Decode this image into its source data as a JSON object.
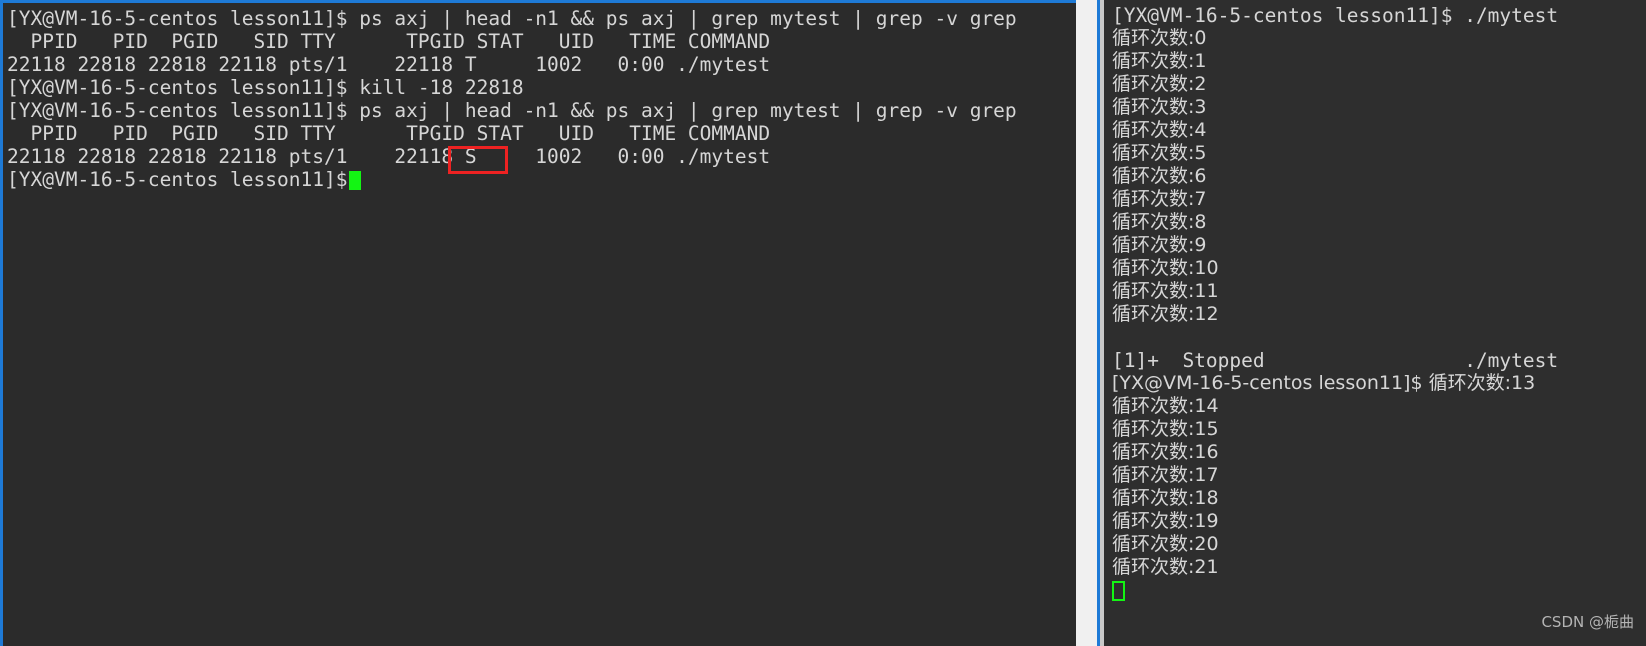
{
  "window": {
    "accent_color": "#1e7ad6",
    "terminal_bg": "#2b2b2b",
    "text_color": "#d6d6d6",
    "cursor_color": "#13f513",
    "highlight_box_color": "#ee2222"
  },
  "left_terminal": {
    "prompt": "[YX@VM-16-5-centos lesson11]$",
    "lines": [
      {
        "type": "command",
        "prompt": "[YX@VM-16-5-centos lesson11]$",
        "text": " ps axj | head -n1 && ps axj | grep mytest | grep -v grep"
      },
      {
        "type": "output",
        "text": "  PPID   PID  PGID   SID TTY      TPGID STAT   UID   TIME COMMAND"
      },
      {
        "type": "output",
        "text": "22118 22818 22818 22118 pts/1    22118 T     1002   0:00 ./mytest"
      },
      {
        "type": "command",
        "prompt": "[YX@VM-16-5-centos lesson11]$",
        "text": " kill -18 22818"
      },
      {
        "type": "command",
        "prompt": "[YX@VM-16-5-centos lesson11]$",
        "text": " ps axj | head -n1 && ps axj | grep mytest | grep -v grep"
      },
      {
        "type": "output",
        "text": "  PPID   PID  PGID   SID TTY      TPGID STAT   UID   TIME COMMAND"
      },
      {
        "type": "output",
        "text": "22118 22818 22818 22118 pts/1    22118 S     1002   0:00 ./mytest"
      },
      {
        "type": "prompt_cursor",
        "prompt": "[YX@VM-16-5-centos lesson11]$",
        "text": ""
      }
    ],
    "highlighted_value": "S"
  },
  "right_terminal": {
    "lines": [
      {
        "type": "command",
        "text": "[YX@VM-16-5-centos lesson11]$ ./mytest"
      },
      {
        "type": "output",
        "text": "循环次数:0"
      },
      {
        "type": "output",
        "text": "循环次数:1"
      },
      {
        "type": "output",
        "text": "循环次数:2"
      },
      {
        "type": "output",
        "text": "循环次数:3"
      },
      {
        "type": "output",
        "text": "循环次数:4"
      },
      {
        "type": "output",
        "text": "循环次数:5"
      },
      {
        "type": "output",
        "text": "循环次数:6"
      },
      {
        "type": "output",
        "text": "循环次数:7"
      },
      {
        "type": "output",
        "text": "循环次数:8"
      },
      {
        "type": "output",
        "text": "循环次数:9"
      },
      {
        "type": "output",
        "text": "循环次数:10"
      },
      {
        "type": "output",
        "text": "循环次数:11"
      },
      {
        "type": "output",
        "text": "循环次数:12"
      },
      {
        "type": "blank",
        "text": ""
      },
      {
        "type": "output",
        "text": "[1]+  Stopped                 ./mytest"
      },
      {
        "type": "command",
        "text": "[YX@VM-16-5-centos lesson11]$ 循环次数:13"
      },
      {
        "type": "output",
        "text": "循环次数:14"
      },
      {
        "type": "output",
        "text": "循环次数:15"
      },
      {
        "type": "output",
        "text": "循环次数:16"
      },
      {
        "type": "output",
        "text": "循环次数:17"
      },
      {
        "type": "output",
        "text": "循环次数:18"
      },
      {
        "type": "output",
        "text": "循环次数:19"
      },
      {
        "type": "output",
        "text": "循环次数:20"
      },
      {
        "type": "output",
        "text": "循环次数:21"
      },
      {
        "type": "cursor",
        "text": ""
      }
    ]
  },
  "watermark": {
    "text": "CSDN @栀曲"
  }
}
